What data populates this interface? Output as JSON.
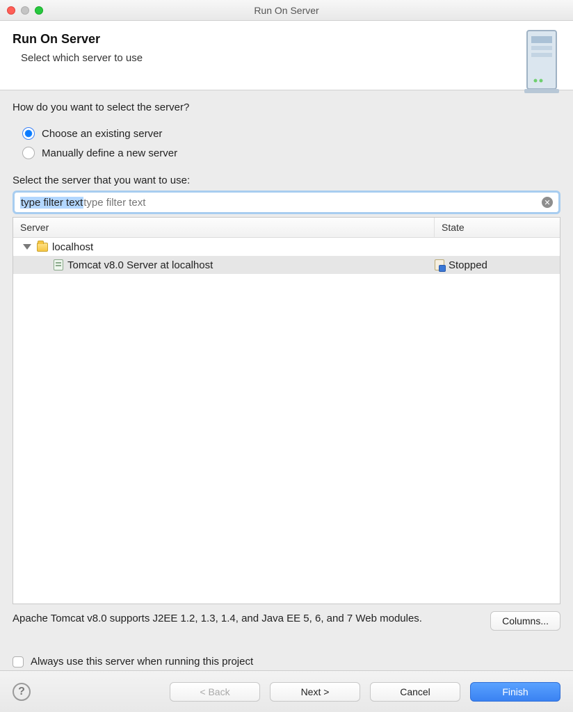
{
  "window": {
    "title": "Run On Server"
  },
  "header": {
    "title": "Run On Server",
    "subtitle": "Select which server to use"
  },
  "prompt": "How do you want to select the server?",
  "radios": {
    "existing": "Choose an existing server",
    "manual": "Manually define a new server",
    "selected": "existing"
  },
  "select_label": "Select the server that you want to use:",
  "filter": {
    "placeholder": "type filter text",
    "value": "type filter text"
  },
  "table": {
    "columns": {
      "server": "Server",
      "state": "State"
    },
    "group": {
      "label": "localhost"
    },
    "rows": [
      {
        "name": "Tomcat v8.0 Server at localhost",
        "state": "Stopped",
        "selected": true
      }
    ]
  },
  "description": "Apache Tomcat v8.0 supports J2EE 1.2, 1.3, 1.4, and Java EE 5, 6, and 7 Web modules.",
  "columns_button": "Columns...",
  "always_use": "Always use this server when running this project",
  "buttons": {
    "back": "< Back",
    "next": "Next >",
    "cancel": "Cancel",
    "finish": "Finish"
  }
}
